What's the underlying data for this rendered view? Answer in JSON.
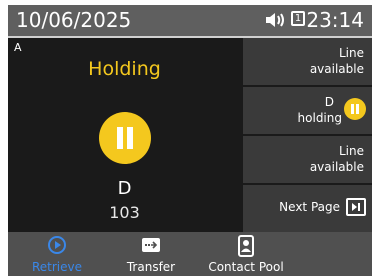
{
  "statusbar": {
    "date": "10/06/2025",
    "time": "23:14",
    "line_number": "1"
  },
  "call": {
    "line": "A",
    "status": "Holding",
    "name": "D",
    "number": "103",
    "accent_color": "#f4c81e"
  },
  "keys": [
    {
      "line1": "Line",
      "line2": "available"
    },
    {
      "line1": "D",
      "line2": "holding"
    },
    {
      "line1": "Line",
      "line2": "available"
    },
    {
      "label": "Next Page"
    }
  ],
  "softkeys": {
    "retrieve": "Retrieve",
    "transfer": "Transfer",
    "contact_pool": "Contact Pool"
  },
  "icons": [
    "speaker-icon",
    "line-icon",
    "pause-icon",
    "next-page-icon",
    "retrieve-icon",
    "transfer-icon",
    "contact-pool-icon"
  ]
}
